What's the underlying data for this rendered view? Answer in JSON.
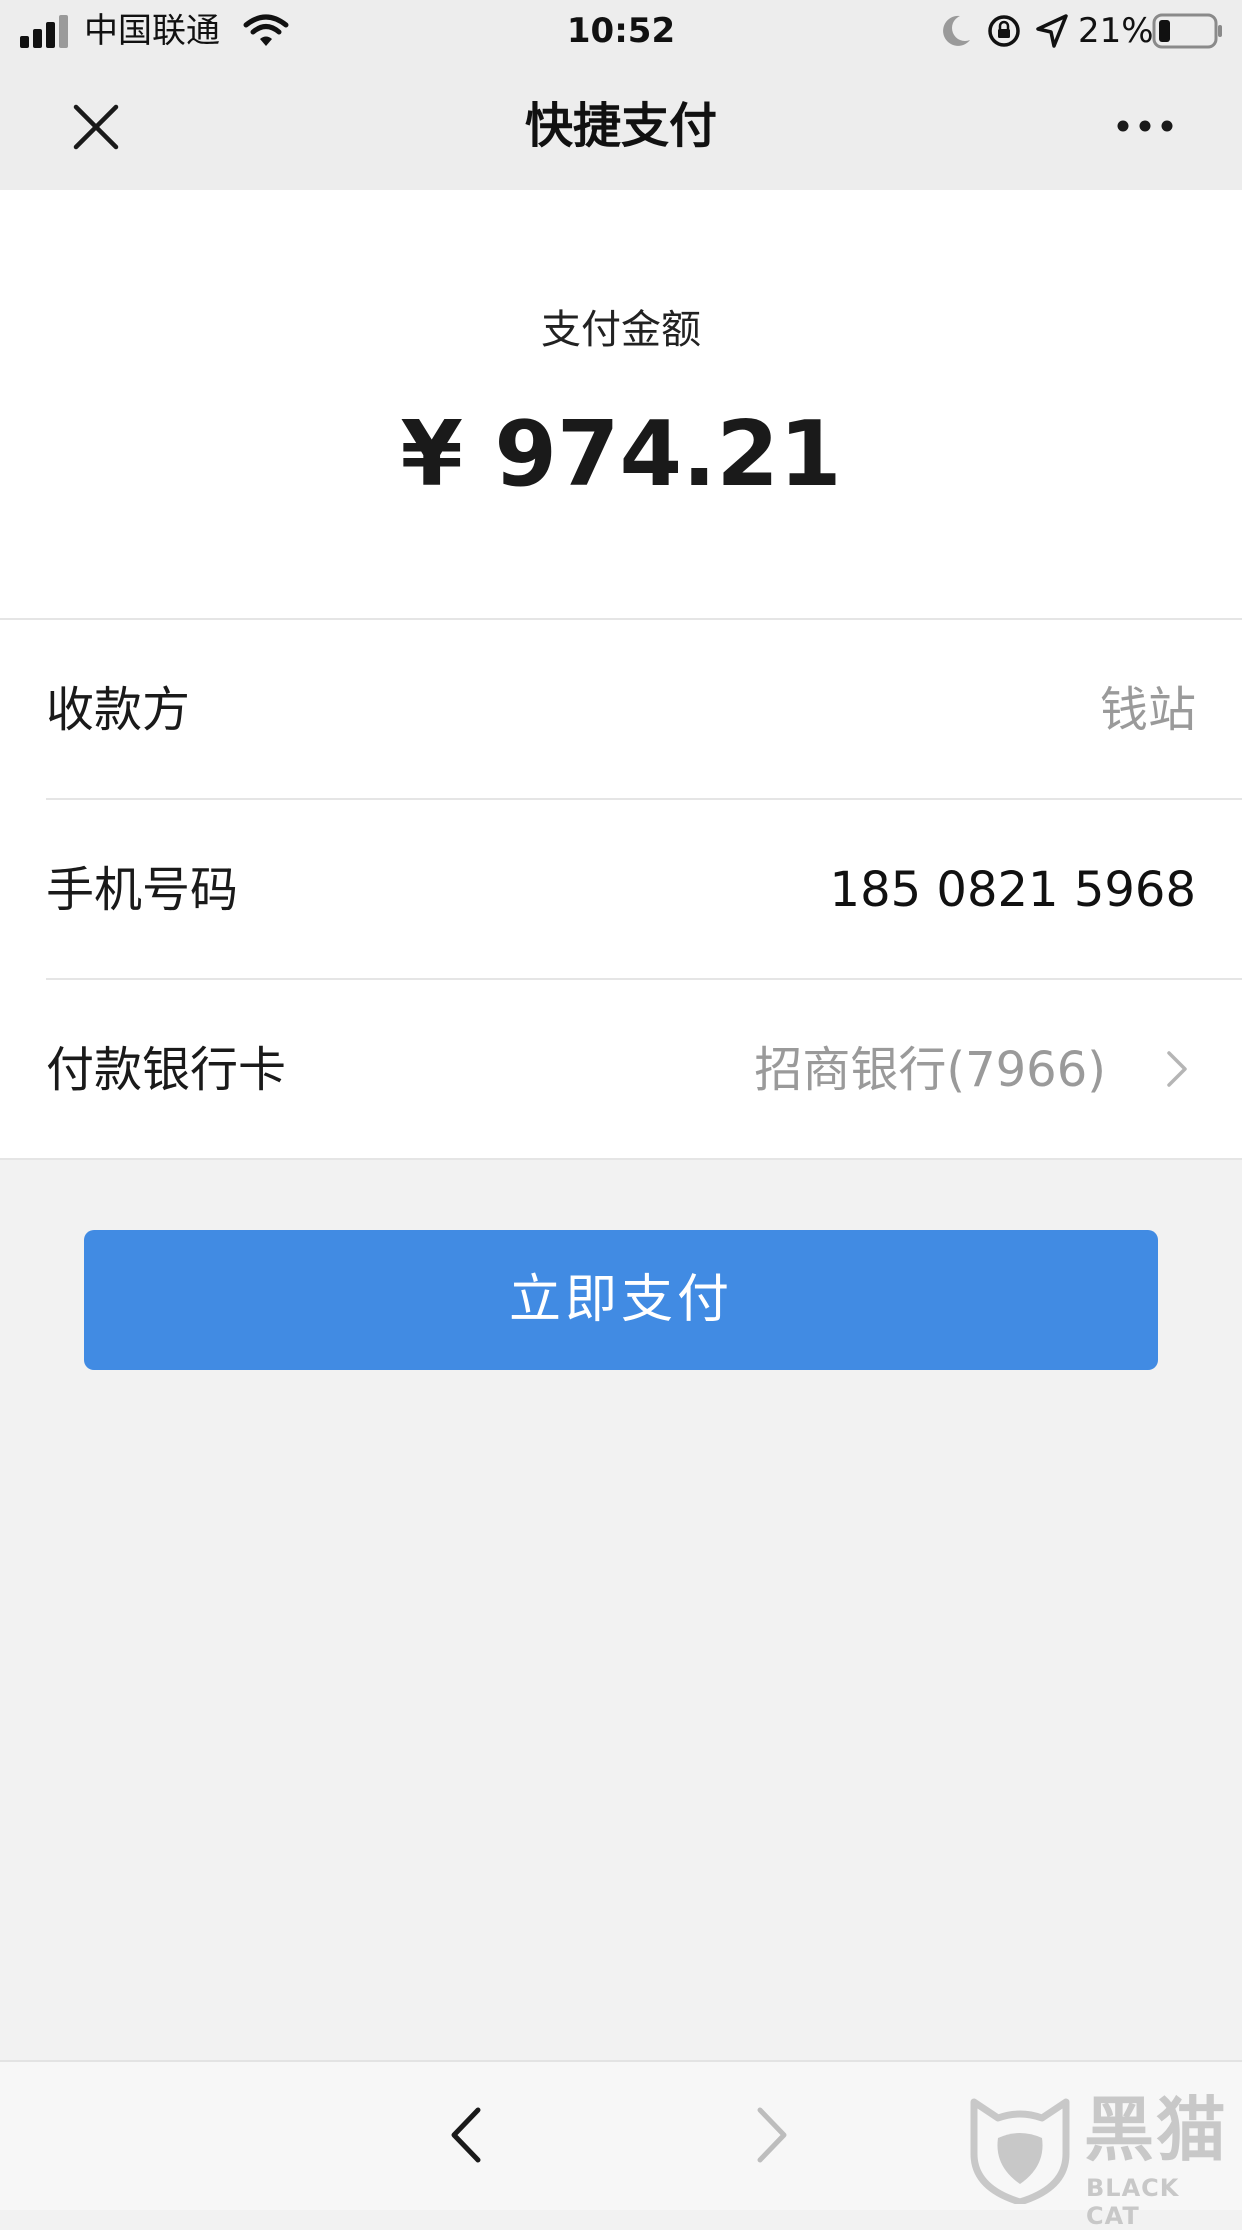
{
  "status_bar": {
    "carrier": "中国联通",
    "time": "10:52",
    "battery_percent": "21%",
    "battery_level": 0.21,
    "icons": [
      "signal-icon",
      "wifi-icon",
      "moon-icon",
      "orientation-lock-icon",
      "location-icon",
      "battery-icon"
    ]
  },
  "nav": {
    "title": "快捷支付",
    "close_icon": "close-icon",
    "more_icon": "more-icon"
  },
  "payment": {
    "amount_label": "支付金额",
    "amount": "¥ 974.21"
  },
  "details": {
    "payee_label": "收款方",
    "payee_value": "钱站",
    "phone_label": "手机号码",
    "phone_value": "185 0821 5968",
    "card_label": "付款银行卡",
    "card_value": "招商银行(7966)"
  },
  "actions": {
    "pay_label": "立即支付"
  },
  "toolbar": {
    "back_icon": "back-arrow-icon",
    "forward_icon": "forward-arrow-icon"
  },
  "watermark": {
    "text_cn": "黑猫",
    "text_en": "BLACK CAT"
  },
  "colors": {
    "primary_button": "#418be3",
    "nav_background": "#ededed",
    "page_background": "#f2f2f2",
    "muted_text": "#9a9a9a"
  }
}
